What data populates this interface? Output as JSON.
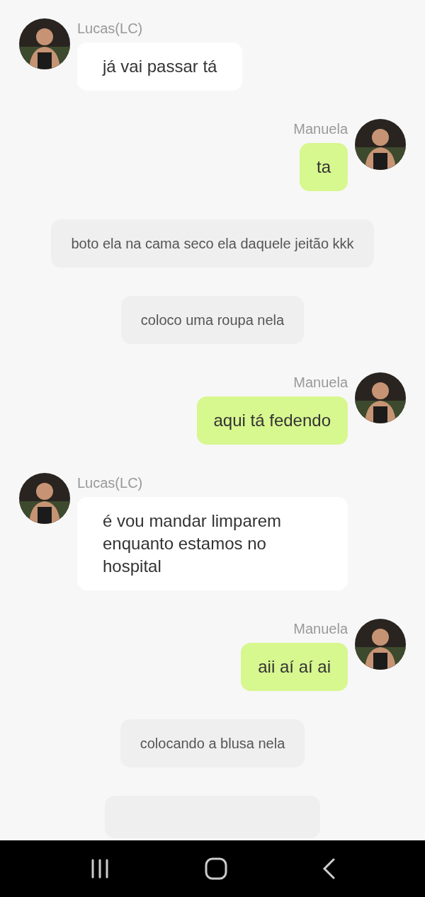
{
  "messages": [
    {
      "kind": "incoming",
      "sender": "Lucas(LC)",
      "text": "já vai passar tá"
    },
    {
      "kind": "outgoing",
      "sender": "Manuela",
      "text": "ta"
    },
    {
      "kind": "narration",
      "text": "boto ela na cama seco ela daquele jeitão kkk"
    },
    {
      "kind": "narration",
      "text": "coloco uma roupa nela"
    },
    {
      "kind": "outgoing",
      "sender": "Manuela",
      "text": "aqui tá fedendo"
    },
    {
      "kind": "incoming",
      "sender": "Lucas(LC)",
      "text": "é vou mandar limparem enquanto estamos no hospital"
    },
    {
      "kind": "outgoing",
      "sender": "Manuela",
      "text": "aii aí aí ai"
    },
    {
      "kind": "narration",
      "text": "colocando a blusa nela"
    },
    {
      "kind": "narration_cut"
    }
  ]
}
